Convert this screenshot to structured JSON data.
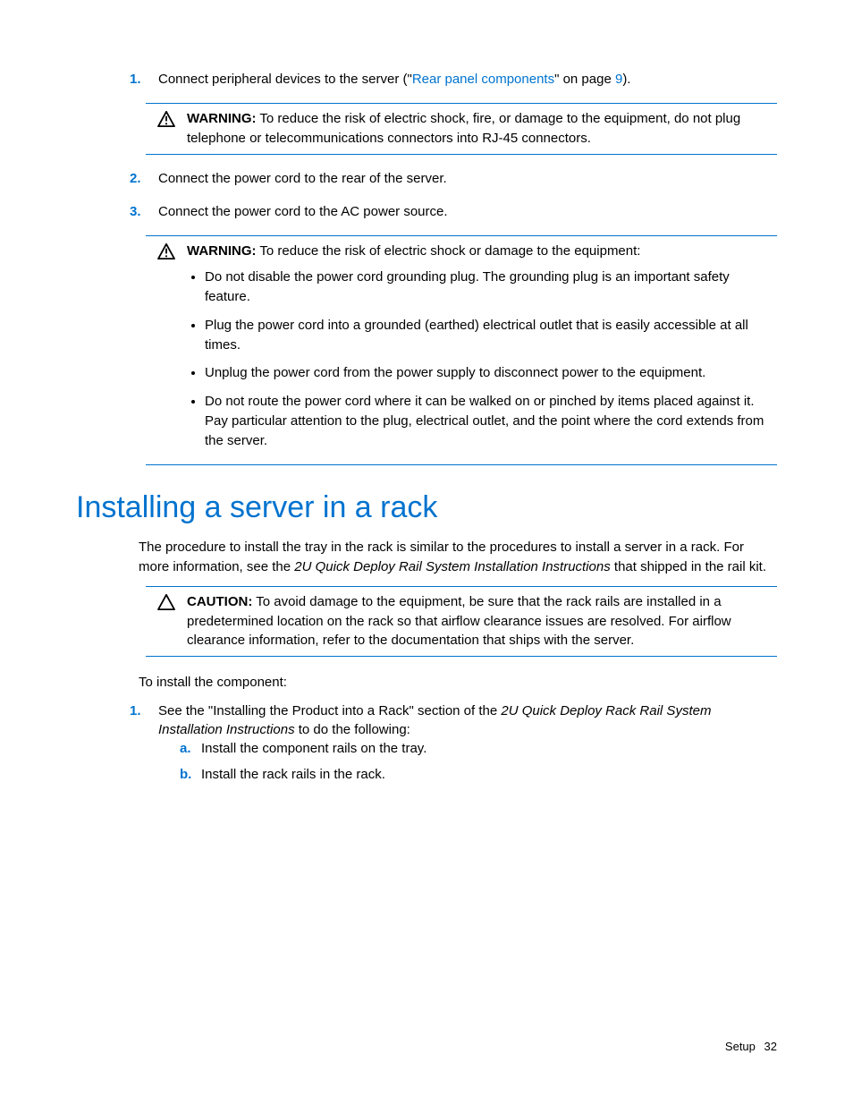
{
  "steps_top": {
    "s1": {
      "num": "1.",
      "pre": "Connect peripheral devices to the server (\"",
      "link": "Rear panel components",
      "mid": "\" on page ",
      "page": "9",
      "post": ")."
    },
    "s2": {
      "num": "2.",
      "text": "Connect the power cord to the rear of the server."
    },
    "s3": {
      "num": "3.",
      "text": "Connect the power cord to the AC power source."
    }
  },
  "warning1": {
    "label": "WARNING:",
    "text": "  To reduce the risk of electric shock, fire, or damage to the equipment, do not plug telephone or telecommunications connectors into RJ-45 connectors."
  },
  "warning2": {
    "label": "WARNING:",
    "intro": "  To reduce the risk of electric shock or damage to the equipment:",
    "bullets": [
      "Do not disable the power cord grounding plug. The grounding plug is an important safety feature.",
      "Plug the power cord into a grounded (earthed) electrical outlet that is easily accessible at all times.",
      "Unplug the power cord from the power supply to disconnect power to the equipment.",
      "Do not route the power cord where it can be walked on or pinched by items placed against it. Pay particular attention to the plug, electrical outlet, and the point where the cord extends from the server."
    ]
  },
  "heading": "Installing a server in a rack",
  "intro_para": {
    "pre": "The procedure to install the tray in the rack is similar to the procedures to install a server in a rack. For more information, see the ",
    "ital": "2U Quick Deploy Rail System Installation Instructions",
    "post": " that shipped in the rail kit."
  },
  "caution": {
    "label": "CAUTION:",
    "text": "  To avoid damage to the equipment, be sure that the rack rails are installed in a predetermined location on the rack so that airflow clearance issues are resolved. For airflow clearance information, refer to the documentation that ships with the server."
  },
  "install_lead": "To install the component:",
  "install_step1": {
    "num": "1.",
    "pre": "See the \"Installing the Product into a Rack\" section of the ",
    "ital": "2U Quick Deploy Rack Rail System Installation Instructions",
    "post": " to do the following:"
  },
  "substeps": {
    "a": {
      "num": "a.",
      "text": "Install the component rails on the tray."
    },
    "b": {
      "num": "b.",
      "text": "Install the rack rails in the rack."
    }
  },
  "footer": {
    "section": "Setup",
    "page": "32"
  }
}
